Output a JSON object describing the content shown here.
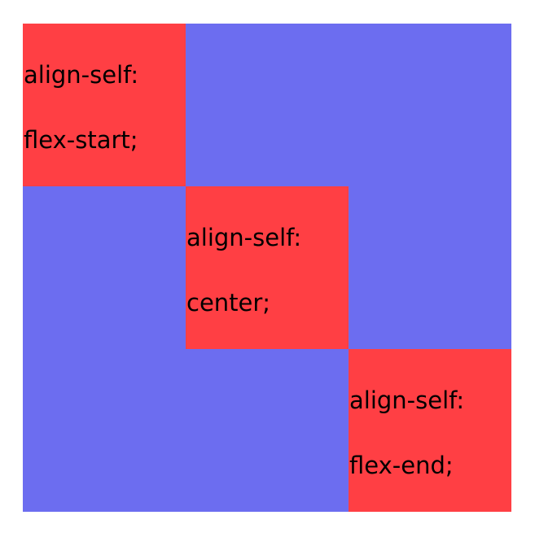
{
  "colors": {
    "container_background": "#6c6df0",
    "item_background": "#ff3f44",
    "text": "#000000"
  },
  "items": [
    {
      "line1": "align-self:",
      "line2": "flex-start;"
    },
    {
      "line1": "align-self:",
      "line2": "center;"
    },
    {
      "line1": "align-self:",
      "line2": "flex-end;"
    }
  ]
}
